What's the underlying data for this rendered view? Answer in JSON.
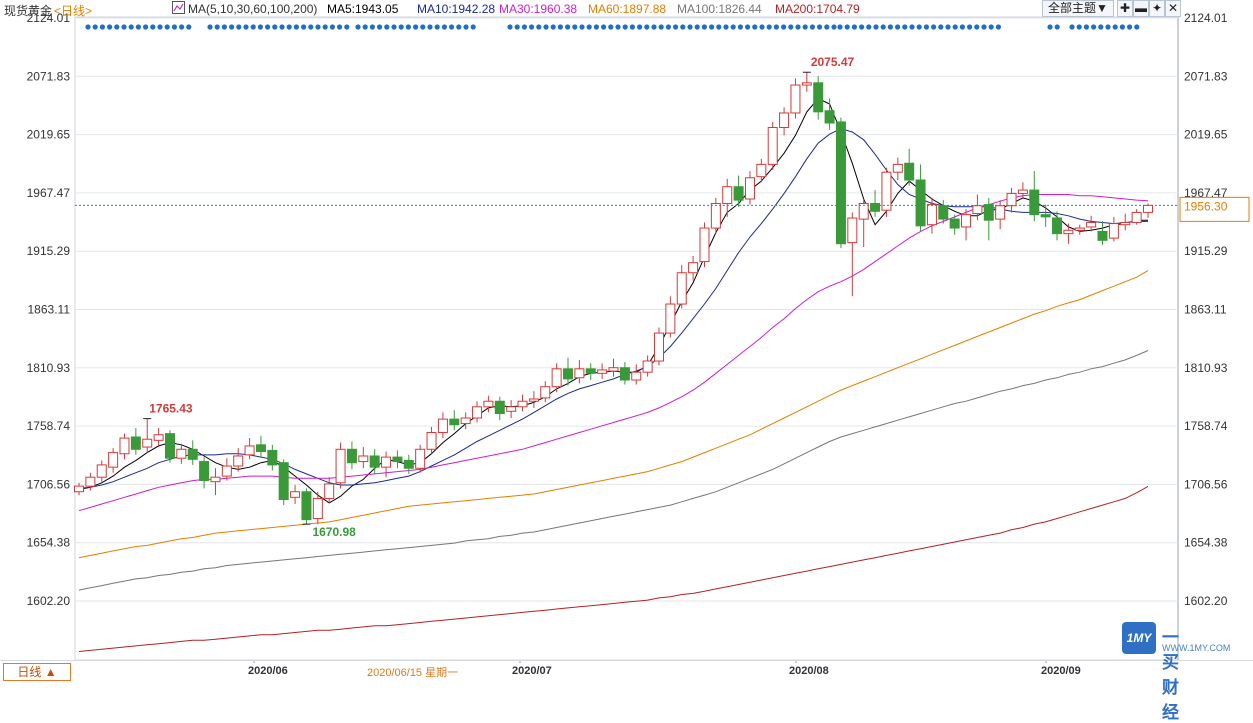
{
  "header": {
    "title": "现货黄金",
    "period": "<日线>",
    "indicator": "MA(5,10,30,60,100,200)",
    "ma_values": [
      {
        "label": "MA5:1943.05",
        "color": "#000000"
      },
      {
        "label": "MA10:1942.28",
        "color": "#1b2a8e"
      },
      {
        "label": "MA30:1960.38",
        "color": "#cc1fcc"
      },
      {
        "label": "MA60:1897.88",
        "color": "#e67e00"
      },
      {
        "label": "MA100:1826.44",
        "color": "#777777"
      },
      {
        "label": "MA200:1704.79",
        "color": "#b22222"
      }
    ],
    "theme_button": "全部主题▼"
  },
  "bottom": {
    "period_button": "日线 ▲",
    "months": [
      "2020/06",
      "2020/07",
      "2020/08",
      "2020/09"
    ],
    "cursor_date": "2020/06/15 星期一"
  },
  "watermark": {
    "text": "一买财经",
    "url": "WWW.1MY.COM",
    "badge": "1MY"
  },
  "colors": {
    "up": "#d43a3a",
    "down": "#3a9a3a",
    "grid": "#e3e6ea",
    "current_line": "#2a8a9a",
    "price_box": "#e67e00"
  },
  "chart_data": {
    "type": "candlestick",
    "title": "现货黄金",
    "y_ticks": [
      2124.01,
      2071.83,
      2019.65,
      1967.47,
      1915.29,
      1863.11,
      1810.93,
      1758.74,
      1706.56,
      1654.38,
      1602.2
    ],
    "ylim": [
      1599,
      2125
    ],
    "current_price": 1956.3,
    "annotations": [
      {
        "label": "2075.47",
        "value": 2075.47,
        "kind": "high"
      },
      {
        "label": "1765.43",
        "value": 1765.43,
        "kind": "high"
      },
      {
        "label": "1670.98",
        "value": 1670.98,
        "kind": "low"
      }
    ],
    "candles": [
      [
        1700,
        1705,
        1708,
        1697
      ],
      [
        1705,
        1713,
        1717,
        1701
      ],
      [
        1713,
        1724,
        1728,
        1709
      ],
      [
        1722,
        1735,
        1739,
        1717
      ],
      [
        1734,
        1748,
        1752,
        1729
      ],
      [
        1749,
        1738,
        1757,
        1733
      ],
      [
        1740,
        1747,
        1765.43,
        1735
      ],
      [
        1746,
        1751,
        1757,
        1740
      ],
      [
        1752,
        1730,
        1755,
        1726
      ],
      [
        1730,
        1738,
        1743,
        1725
      ],
      [
        1738,
        1729,
        1746,
        1724
      ],
      [
        1727,
        1710,
        1731,
        1703
      ],
      [
        1709,
        1713,
        1721,
        1697
      ],
      [
        1714,
        1723,
        1730,
        1710
      ],
      [
        1723,
        1732,
        1739,
        1718
      ],
      [
        1733,
        1741,
        1748,
        1729
      ],
      [
        1742,
        1736,
        1750,
        1731
      ],
      [
        1737,
        1724,
        1742,
        1719
      ],
      [
        1726,
        1693,
        1729,
        1688
      ],
      [
        1695,
        1700,
        1706,
        1689
      ],
      [
        1700,
        1675,
        1703,
        1670.98
      ],
      [
        1676,
        1694,
        1700,
        1671
      ],
      [
        1694,
        1707,
        1713,
        1690
      ],
      [
        1708,
        1738,
        1744,
        1703
      ],
      [
        1738,
        1726,
        1745,
        1720
      ],
      [
        1727,
        1732,
        1740,
        1721
      ],
      [
        1732,
        1722,
        1738,
        1716
      ],
      [
        1722,
        1731,
        1736,
        1713
      ],
      [
        1731,
        1727,
        1737,
        1721
      ],
      [
        1728,
        1721,
        1733,
        1716
      ],
      [
        1721,
        1738,
        1742,
        1717
      ],
      [
        1738,
        1753,
        1758,
        1734
      ],
      [
        1753,
        1765,
        1771,
        1748
      ],
      [
        1765,
        1760,
        1773,
        1755
      ],
      [
        1761,
        1766,
        1771,
        1756
      ],
      [
        1766,
        1776,
        1781,
        1762
      ],
      [
        1776,
        1781,
        1786,
        1771
      ],
      [
        1781,
        1770,
        1785,
        1764
      ],
      [
        1772,
        1776,
        1782,
        1766
      ],
      [
        1776,
        1781,
        1787,
        1772
      ],
      [
        1781,
        1783,
        1790,
        1775
      ],
      [
        1784,
        1794,
        1799,
        1780
      ],
      [
        1794,
        1810,
        1815,
        1789
      ],
      [
        1810,
        1801,
        1820,
        1795
      ],
      [
        1802,
        1810,
        1818,
        1797
      ],
      [
        1810,
        1806,
        1815,
        1800
      ],
      [
        1806,
        1809,
        1815,
        1801
      ],
      [
        1808,
        1811,
        1819,
        1803
      ],
      [
        1811,
        1800,
        1816,
        1796
      ],
      [
        1800,
        1807,
        1814,
        1796
      ],
      [
        1807,
        1817,
        1822,
        1803
      ],
      [
        1817,
        1842,
        1847,
        1813
      ],
      [
        1842,
        1868,
        1875,
        1838
      ],
      [
        1868,
        1896,
        1903,
        1864
      ],
      [
        1896,
        1905,
        1911,
        1889
      ],
      [
        1906,
        1936,
        1941,
        1901
      ],
      [
        1936,
        1958,
        1963,
        1931
      ],
      [
        1958,
        1973,
        1980,
        1946
      ],
      [
        1973,
        1961,
        1983,
        1955
      ],
      [
        1962,
        1981,
        1987,
        1957
      ],
      [
        1982,
        1993,
        1998,
        1977
      ],
      [
        1993,
        2026,
        2031,
        1988
      ],
      [
        2026,
        2039,
        2044,
        2019
      ],
      [
        2039,
        2064,
        2070,
        2034
      ],
      [
        2064,
        2066,
        2075.47,
        2058
      ],
      [
        2066,
        2040,
        2072,
        2033
      ],
      [
        2041,
        2030,
        2052,
        2024
      ],
      [
        2031,
        1922,
        2035,
        1918
      ],
      [
        1923,
        1945,
        1950,
        1875
      ],
      [
        1944,
        1958,
        1962,
        1919
      ],
      [
        1958,
        1951,
        1970,
        1946
      ],
      [
        1952,
        1986,
        1990,
        1946
      ],
      [
        1986,
        1993,
        1999,
        1979
      ],
      [
        1994,
        1979,
        2007,
        1974
      ],
      [
        1979,
        1938,
        1993,
        1933
      ],
      [
        1939,
        1957,
        1963,
        1931
      ],
      [
        1956,
        1944,
        1961,
        1940
      ],
      [
        1944,
        1936,
        1948,
        1930
      ],
      [
        1937,
        1948,
        1953,
        1925
      ],
      [
        1949,
        1956,
        1966,
        1943
      ],
      [
        1957,
        1943,
        1963,
        1925
      ],
      [
        1944,
        1956,
        1961,
        1935
      ],
      [
        1956,
        1967,
        1972,
        1950
      ],
      [
        1967,
        1970,
        1977,
        1962
      ],
      [
        1970,
        1948,
        1987,
        1942
      ],
      [
        1948,
        1946,
        1957,
        1937
      ],
      [
        1945,
        1931,
        1951,
        1925
      ],
      [
        1931,
        1934,
        1940,
        1922
      ],
      [
        1934,
        1936,
        1939,
        1930
      ],
      [
        1937,
        1941,
        1947,
        1933
      ],
      [
        1933,
        1925,
        1942,
        1921
      ],
      [
        1927,
        1940,
        1946,
        1924
      ],
      [
        1939,
        1941,
        1949,
        1934
      ],
      [
        1941,
        1950,
        1953,
        1939
      ],
      [
        1950,
        1956.3,
        1958,
        1945
      ]
    ],
    "series": [
      {
        "name": "MA5",
        "color": "#000000",
        "values": [
          1702,
          1704,
          1708,
          1714,
          1722,
          1728,
          1735,
          1741,
          1744,
          1742,
          1738,
          1732,
          1726,
          1722,
          1720,
          1722,
          1726,
          1728,
          1722,
          1714,
          1706,
          1697,
          1690,
          1696,
          1705,
          1711,
          1721,
          1729,
          1727,
          1724,
          1726,
          1734,
          1744,
          1752,
          1761,
          1768,
          1775,
          1777,
          1776,
          1777,
          1780,
          1785,
          1792,
          1797,
          1803,
          1806,
          1807,
          1808,
          1807,
          1807,
          1813,
          1830,
          1850,
          1870,
          1887,
          1910,
          1932,
          1950,
          1958,
          1970,
          1978,
          1990,
          2003,
          2019,
          2040,
          2052,
          2047,
          2022,
          1994,
          1962,
          1939,
          1951,
          1967,
          1978,
          1970,
          1962,
          1956,
          1951,
          1947,
          1947,
          1952,
          1953,
          1958,
          1963,
          1960,
          1954,
          1946,
          1937,
          1933,
          1934,
          1936,
          1939,
          1940,
          1943,
          1943
        ]
      },
      {
        "name": "MA10",
        "color": "#1b2a8e",
        "values": [
          1703,
          1704,
          1706,
          1709,
          1713,
          1717,
          1721,
          1726,
          1729,
          1732,
          1733,
          1733,
          1733,
          1734,
          1734,
          1733,
          1731,
          1729,
          1725,
          1720,
          1716,
          1712,
          1708,
          1706,
          1706,
          1707,
          1708,
          1710,
          1712,
          1714,
          1718,
          1723,
          1728,
          1733,
          1739,
          1745,
          1750,
          1755,
          1760,
          1765,
          1771,
          1777,
          1783,
          1788,
          1792,
          1795,
          1798,
          1801,
          1805,
          1808,
          1812,
          1820,
          1830,
          1842,
          1855,
          1868,
          1882,
          1898,
          1914,
          1928,
          1940,
          1953,
          1967,
          1982,
          1998,
          2012,
          2020,
          2025,
          2022,
          2015,
          2002,
          1988,
          1975,
          1966,
          1962,
          1958,
          1956,
          1955,
          1955,
          1955,
          1955,
          1953,
          1951,
          1950,
          1950,
          1950,
          1949,
          1947,
          1944,
          1942,
          1941,
          1940,
          1941,
          1942,
          1942
        ]
      },
      {
        "name": "MA30",
        "color": "#cc1fcc",
        "values": [
          1683,
          1686,
          1689,
          1692,
          1695,
          1698,
          1701,
          1704,
          1706,
          1708,
          1710,
          1711,
          1711,
          1712,
          1713,
          1714,
          1714,
          1714,
          1713,
          1712,
          1712,
          1712,
          1712,
          1713,
          1714,
          1715,
          1716,
          1717,
          1718,
          1719,
          1720,
          1722,
          1724,
          1726,
          1728,
          1730,
          1732,
          1734,
          1736,
          1738,
          1741,
          1744,
          1747,
          1750,
          1753,
          1756,
          1759,
          1762,
          1765,
          1768,
          1771,
          1775,
          1780,
          1785,
          1791,
          1798,
          1806,
          1814,
          1822,
          1830,
          1838,
          1847,
          1855,
          1864,
          1872,
          1879,
          1884,
          1888,
          1893,
          1899,
          1906,
          1913,
          1920,
          1927,
          1933,
          1938,
          1942,
          1946,
          1950,
          1954,
          1957,
          1960,
          1963,
          1965,
          1966,
          1966,
          1966,
          1966,
          1965,
          1965,
          1964,
          1963,
          1962,
          1961,
          1960.38
        ]
      },
      {
        "name": "MA60",
        "color": "#e67e00",
        "values": [
          1641,
          1643,
          1645,
          1647,
          1649,
          1651,
          1652,
          1654,
          1656,
          1658,
          1659,
          1661,
          1663,
          1664,
          1665,
          1666,
          1667,
          1668,
          1669,
          1670,
          1671,
          1672,
          1673,
          1675,
          1677,
          1679,
          1681,
          1683,
          1685,
          1687,
          1688,
          1689,
          1690,
          1691,
          1692,
          1693,
          1694,
          1695,
          1696,
          1697,
          1698,
          1700,
          1702,
          1704,
          1706,
          1708,
          1710,
          1712,
          1714,
          1716,
          1718,
          1721,
          1724,
          1727,
          1731,
          1735,
          1739,
          1743,
          1747,
          1751,
          1756,
          1761,
          1766,
          1771,
          1776,
          1781,
          1786,
          1791,
          1795,
          1799,
          1803,
          1807,
          1811,
          1815,
          1819,
          1823,
          1827,
          1831,
          1835,
          1839,
          1843,
          1847,
          1851,
          1855,
          1859,
          1862,
          1866,
          1869,
          1872,
          1876,
          1880,
          1884,
          1888,
          1892,
          1897.88
        ]
      },
      {
        "name": "MA100",
        "color": "#777777",
        "values": [
          1612,
          1614,
          1616,
          1618,
          1620,
          1622,
          1623,
          1625,
          1626,
          1628,
          1629,
          1631,
          1632,
          1634,
          1635,
          1636,
          1637,
          1638,
          1639,
          1640,
          1641,
          1642,
          1643,
          1644,
          1645,
          1646,
          1647,
          1648,
          1649,
          1650,
          1651,
          1652,
          1653,
          1654,
          1656,
          1657,
          1658,
          1660,
          1661,
          1663,
          1664,
          1666,
          1668,
          1670,
          1672,
          1674,
          1676,
          1678,
          1680,
          1682,
          1684,
          1686,
          1688,
          1691,
          1694,
          1697,
          1700,
          1704,
          1708,
          1712,
          1716,
          1720,
          1725,
          1730,
          1735,
          1740,
          1745,
          1749,
          1752,
          1755,
          1758,
          1761,
          1764,
          1767,
          1770,
          1773,
          1776,
          1779,
          1781,
          1784,
          1787,
          1790,
          1792,
          1795,
          1797,
          1800,
          1802,
          1805,
          1807,
          1810,
          1812,
          1815,
          1818,
          1822,
          1826.44
        ]
      },
      {
        "name": "MA200",
        "color": "#b22222",
        "values": [
          1557,
          1558,
          1559,
          1560,
          1561,
          1562,
          1563,
          1564,
          1565,
          1566,
          1567,
          1567,
          1568,
          1569,
          1570,
          1571,
          1572,
          1572,
          1573,
          1574,
          1575,
          1576,
          1576,
          1577,
          1578,
          1579,
          1580,
          1580,
          1581,
          1582,
          1583,
          1584,
          1585,
          1586,
          1587,
          1588,
          1589,
          1590,
          1591,
          1592,
          1593,
          1594,
          1595,
          1596,
          1597,
          1598,
          1599,
          1600,
          1601,
          1602,
          1603,
          1605,
          1606,
          1608,
          1609,
          1611,
          1613,
          1615,
          1617,
          1619,
          1621,
          1623,
          1625,
          1627,
          1629,
          1631,
          1633,
          1635,
          1637,
          1639,
          1641,
          1643,
          1645,
          1647,
          1649,
          1651,
          1653,
          1655,
          1657,
          1659,
          1661,
          1663,
          1666,
          1668,
          1671,
          1673,
          1676,
          1679,
          1682,
          1685,
          1688,
          1691,
          1694,
          1699,
          1704.79
        ]
      }
    ]
  }
}
